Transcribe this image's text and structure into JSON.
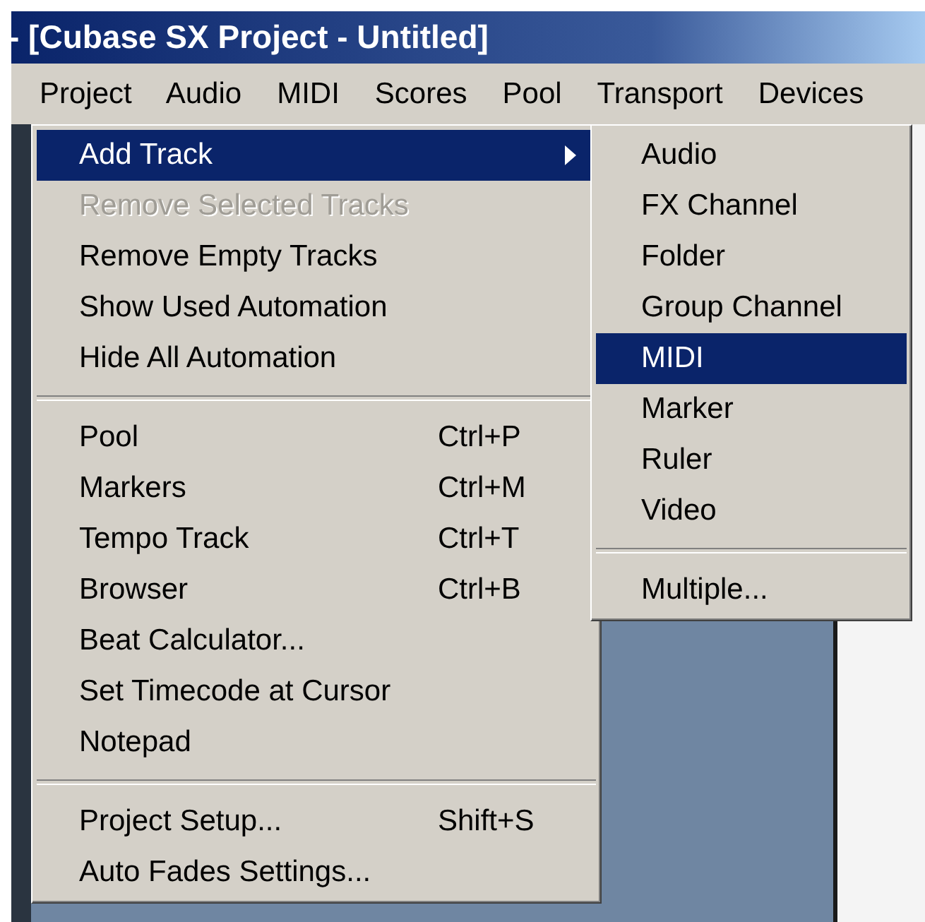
{
  "window": {
    "title": "- [Cubase SX Project - Untitled]"
  },
  "menu_bar": [
    {
      "label": "Project",
      "selected": true
    },
    {
      "label": "Audio",
      "selected": false
    },
    {
      "label": "MIDI",
      "selected": false
    },
    {
      "label": "Scores",
      "selected": false
    },
    {
      "label": "Pool",
      "selected": false
    },
    {
      "label": "Transport",
      "selected": false
    },
    {
      "label": "Devices",
      "selected": false
    }
  ],
  "project_menu": {
    "groups": [
      [
        {
          "label": "Add Track",
          "selected": true,
          "disabled": false,
          "submenu": true
        },
        {
          "label": "Remove Selected Tracks",
          "selected": false,
          "disabled": true,
          "submenu": false
        },
        {
          "label": "Remove Empty Tracks",
          "selected": false,
          "disabled": false,
          "submenu": false
        },
        {
          "label": "Show Used Automation",
          "selected": false,
          "disabled": false,
          "submenu": false
        },
        {
          "label": "Hide All Automation",
          "selected": false,
          "disabled": false,
          "submenu": false
        }
      ],
      [
        {
          "label": "Pool",
          "shortcut": "Ctrl+P",
          "selected": false,
          "disabled": false,
          "submenu": false
        },
        {
          "label": "Markers",
          "shortcut": "Ctrl+M",
          "selected": false,
          "disabled": false,
          "submenu": false
        },
        {
          "label": "Tempo Track",
          "shortcut": "Ctrl+T",
          "selected": false,
          "disabled": false,
          "submenu": false
        },
        {
          "label": "Browser",
          "shortcut": "Ctrl+B",
          "selected": false,
          "disabled": false,
          "submenu": false
        },
        {
          "label": "Beat Calculator...",
          "selected": false,
          "disabled": false,
          "submenu": false
        },
        {
          "label": "Set Timecode at Cursor",
          "selected": false,
          "disabled": false,
          "submenu": false
        },
        {
          "label": "Notepad",
          "selected": false,
          "disabled": false,
          "submenu": false
        }
      ],
      [
        {
          "label": "Project Setup...",
          "shortcut": "Shift+S",
          "selected": false,
          "disabled": false,
          "submenu": false
        },
        {
          "label": "Auto Fades Settings...",
          "selected": false,
          "disabled": false,
          "submenu": false
        }
      ]
    ]
  },
  "add_track_submenu": {
    "groups": [
      [
        {
          "label": "Audio",
          "selected": false,
          "disabled": false,
          "submenu": false
        },
        {
          "label": "FX Channel",
          "selected": false,
          "disabled": false,
          "submenu": false
        },
        {
          "label": "Folder",
          "selected": false,
          "disabled": false,
          "submenu": false
        },
        {
          "label": "Group Channel",
          "selected": false,
          "disabled": false,
          "submenu": false
        },
        {
          "label": "MIDI",
          "selected": true,
          "disabled": false,
          "submenu": false
        },
        {
          "label": "Marker",
          "selected": false,
          "disabled": false,
          "submenu": false
        },
        {
          "label": "Ruler",
          "selected": false,
          "disabled": false,
          "submenu": false
        },
        {
          "label": "Video",
          "selected": false,
          "disabled": false,
          "submenu": false
        }
      ],
      [
        {
          "label": "Multiple...",
          "selected": false,
          "disabled": false,
          "submenu": false
        }
      ]
    ]
  }
}
